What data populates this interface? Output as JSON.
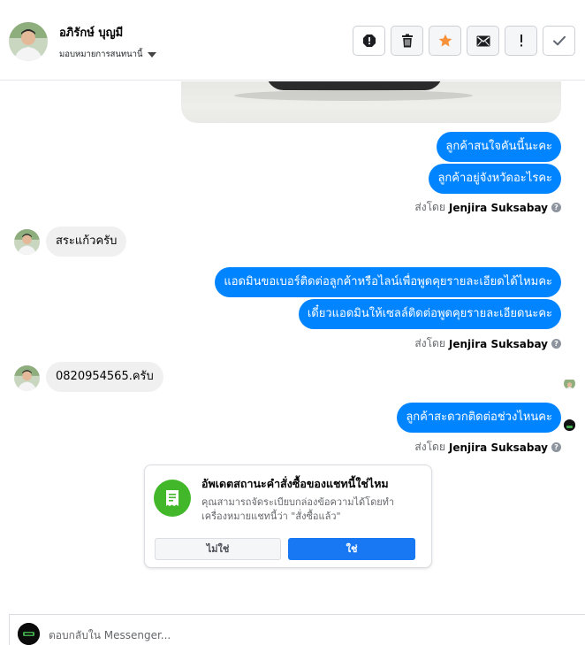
{
  "header": {
    "contact_name": "อภิรักษ์ บุญมี",
    "assign_label": "มอบหมายการสนทนานี้",
    "actions": [
      {
        "name": "spam-button",
        "icon": "alert-icon"
      },
      {
        "name": "delete-button",
        "icon": "trash-icon"
      },
      {
        "name": "follow-up-button",
        "icon": "star-icon"
      },
      {
        "name": "mark-unread-button",
        "icon": "envelope-icon"
      },
      {
        "name": "mark-important-button",
        "icon": "exclamation-icon"
      },
      {
        "name": "mark-done-button",
        "icon": "checkmark-icon"
      }
    ]
  },
  "thread": {
    "messages": [
      {
        "direction": "out",
        "type": "image"
      },
      {
        "direction": "out",
        "text": "ลูกค้าสนใจคันนี้นะคะ"
      },
      {
        "direction": "out",
        "text": "ลูกค้าอยู่จังหวัดอะไรคะ"
      },
      {
        "direction": "in",
        "text": "สระแก้วครับ"
      },
      {
        "direction": "out",
        "text": "แอดมินขอเบอร์ติดต่อลูกค้าหรือไลน์เพื่อพูดคุยรายละเอียดได้ไหมคะ"
      },
      {
        "direction": "out",
        "text": "เดี๋ยวแอดมินให้เซลล์ติดต่อพูดคุยรายละเอียดนะคะ"
      },
      {
        "direction": "in",
        "text": "0820954565.ครับ"
      },
      {
        "direction": "out",
        "text": "ลูกค้าสะดวกติดต่อช่วงไหนคะ"
      }
    ],
    "sent_by_prefix": "ส่งโดย",
    "sent_by_name": "Jenjira Suksabay",
    "info_glyph": "?"
  },
  "order_card": {
    "title": "อัพเดตสถานะคำสั่งซื้อของแชทนี้ใช่ไหม",
    "description": "คุณสามารถจัดระเบียบกล่องข้อความได้โดยทำเครื่องหมายแชทนี้ว่า \"สั่งซื้อแล้ว\"",
    "no_label": "ไม่ใช่",
    "yes_label": "ใช่",
    "icon": "receipt-icon",
    "accent_color": "#42b72a"
  },
  "composer": {
    "placeholder": "ตอบกลับใน Messenger..."
  },
  "colors": {
    "outgoing_bubble": "#0084ff",
    "incoming_bubble": "#f0f0f0",
    "primary_button": "#1877f2",
    "star": "#f7923b"
  }
}
